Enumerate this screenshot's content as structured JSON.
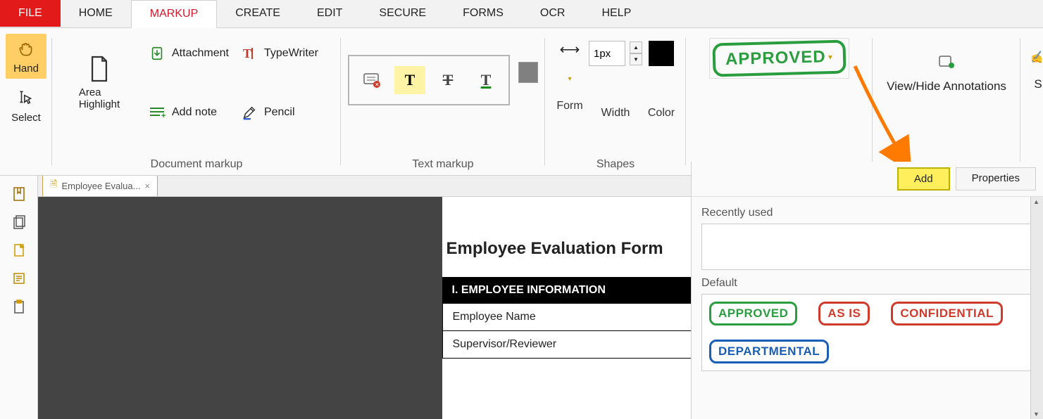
{
  "menu": {
    "file": "FILE",
    "home": "HOME",
    "markup": "MARKUP",
    "create": "CREATE",
    "edit": "EDIT",
    "secure": "SECURE",
    "forms": "FORMS",
    "ocr": "OCR",
    "help": "HELP"
  },
  "ribbon": {
    "hand": "Hand",
    "select": "Select",
    "area_highlight": "Area Highlight",
    "attachment": "Attachment",
    "typewriter": "TypeWriter",
    "add_note": "Add note",
    "pencil": "Pencil",
    "group_doc_markup": "Document markup",
    "group_text_markup": "Text markup",
    "group_shapes": "Shapes",
    "shapes_form": "Form",
    "shapes_width": "Width",
    "shapes_color": "Color",
    "line_px": "1px",
    "approved_stamp": "APPROVED",
    "view_hide": "View/Hide Annotations",
    "signatures_partial": "S"
  },
  "tab": {
    "name": "Employee Evalua...",
    "close": "×"
  },
  "document": {
    "title": "Employee Evaluation Form",
    "section1": "I. EMPLOYEE INFORMATION",
    "row1": "Employee Name",
    "row2": "Supervisor/Reviewer"
  },
  "stamps_panel": {
    "add": "Add",
    "properties": "Properties",
    "recently_used": "Recently used",
    "default": "Default",
    "items": {
      "approved": "APPROVED",
      "as_is": "AS IS",
      "confidential": "CONFIDENTIAL",
      "departmental": "DEPARTMENTAL"
    }
  }
}
